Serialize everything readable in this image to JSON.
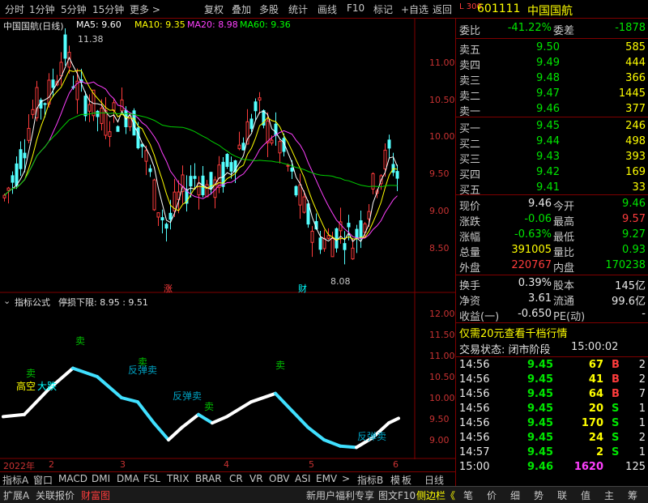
{
  "toolbar": {
    "items": [
      "分时",
      "1分钟",
      "5分钟",
      "15分钟",
      "更多 >",
      "复权",
      "叠加",
      "多股",
      "统计",
      "画线",
      "F10",
      "标记",
      "+自选",
      "返回"
    ]
  },
  "kline": {
    "title": "中国国航(日线)",
    "ma5": "MA5: 9.60",
    "ma10": "MA10: 9.35",
    "ma20": "MA20: 8.98",
    "ma60": "MA60: 9.36",
    "high_label": "11.38",
    "low_label": "8.08",
    "tag_zhang": "涨",
    "tag_cai": "财",
    "yticks": [
      "11.00",
      "10.50",
      "10.00",
      "9.50",
      "9.00",
      "8.50"
    ]
  },
  "indicator": {
    "title": "指标公式",
    "subtitle": "停损下限: 8.95 : 9.51",
    "yticks": [
      "12.00",
      "11.50",
      "11.00",
      "10.50",
      "10.00",
      "9.50",
      "9.00"
    ],
    "labels": [
      "卖",
      "卖",
      "卖",
      "卖",
      "卖",
      "高空",
      "大跌",
      "反弹卖",
      "反弹卖",
      "反弹卖"
    ]
  },
  "dates": [
    "2022年",
    "2",
    "3",
    "4",
    "5",
    "6"
  ],
  "tabs": [
    "指标A",
    "窗口",
    "MACD",
    "DMI",
    "DMA",
    "FSL",
    "TRIX",
    "BRAR",
    "CR",
    "VR",
    "OBV",
    "ASI",
    "EMV",
    ">",
    "指标B",
    "模",
    "板",
    "日线"
  ],
  "status": {
    "left": [
      "扩展A",
      "关联报价",
      "财富图"
    ],
    "mid": [
      "新用户福利专享",
      "图文F10",
      "侧边栏《"
    ],
    "right": [
      "笔",
      "价",
      "细",
      "势",
      "联",
      "值",
      "主",
      "筹"
    ]
  },
  "quote": {
    "code": "601111",
    "name": "中国国航",
    "webi_label": "委比",
    "webi": "-41.22%",
    "weicha_label": "委差",
    "weicha": "-1878",
    "sells": [
      {
        "label": "卖五",
        "price": "9.50",
        "vol": "585"
      },
      {
        "label": "卖四",
        "price": "9.49",
        "vol": "444"
      },
      {
        "label": "卖三",
        "price": "9.48",
        "vol": "366"
      },
      {
        "label": "卖二",
        "price": "9.47",
        "vol": "1445"
      },
      {
        "label": "卖一",
        "price": "9.46",
        "vol": "377"
      }
    ],
    "buys": [
      {
        "label": "买一",
        "price": "9.45",
        "vol": "246"
      },
      {
        "label": "买二",
        "price": "9.44",
        "vol": "498"
      },
      {
        "label": "买三",
        "price": "9.43",
        "vol": "393"
      },
      {
        "label": "买四",
        "price": "9.42",
        "vol": "169"
      },
      {
        "label": "买五",
        "price": "9.41",
        "vol": "33"
      }
    ],
    "stats": [
      {
        "l1": "现价",
        "v1": "9.46",
        "l2": "今开",
        "v2": "9.46"
      },
      {
        "l1": "涨跌",
        "v1": "-0.06",
        "l2": "最高",
        "v2": "9.57"
      },
      {
        "l1": "涨幅",
        "v1": "-0.63%",
        "l2": "最低",
        "v2": "9.27"
      },
      {
        "l1": "总量",
        "v1": "391005",
        "l2": "量比",
        "v2": "0.93"
      },
      {
        "l1": "外盘",
        "v1": "220767",
        "l2": "内盘",
        "v2": "170238"
      }
    ],
    "stats2": [
      {
        "l1": "换手",
        "v1": "0.39%",
        "l2": "股本",
        "v2": "145亿"
      },
      {
        "l1": "净资",
        "v1": "3.61",
        "l2": "流通",
        "v2": "99.6亿"
      },
      {
        "l1": "收益(一)",
        "v1": "-0.650",
        "l2": "PE(动)",
        "v2": "-"
      }
    ],
    "promo": "仅需20元查看千档行情",
    "trade_status": "交易状态: 闭市阶段",
    "trade_time": "15:00:02",
    "ticks": [
      {
        "t": "14:56",
        "p": "9.45",
        "v": "67",
        "f": "B",
        "n": "2"
      },
      {
        "t": "14:56",
        "p": "9.45",
        "v": "41",
        "f": "B",
        "n": "2"
      },
      {
        "t": "14:56",
        "p": "9.45",
        "v": "64",
        "f": "B",
        "n": "7"
      },
      {
        "t": "14:56",
        "p": "9.45",
        "v": "20",
        "f": "S",
        "n": "1"
      },
      {
        "t": "14:56",
        "p": "9.45",
        "v": "170",
        "f": "S",
        "n": "1"
      },
      {
        "t": "14:56",
        "p": "9.45",
        "v": "24",
        "f": "S",
        "n": "2"
      },
      {
        "t": "14:57",
        "p": "9.45",
        "v": "2",
        "f": "S",
        "n": "1"
      },
      {
        "t": "15:00",
        "p": "9.46",
        "v": "1620",
        "f": "",
        "n": "125"
      }
    ]
  }
}
